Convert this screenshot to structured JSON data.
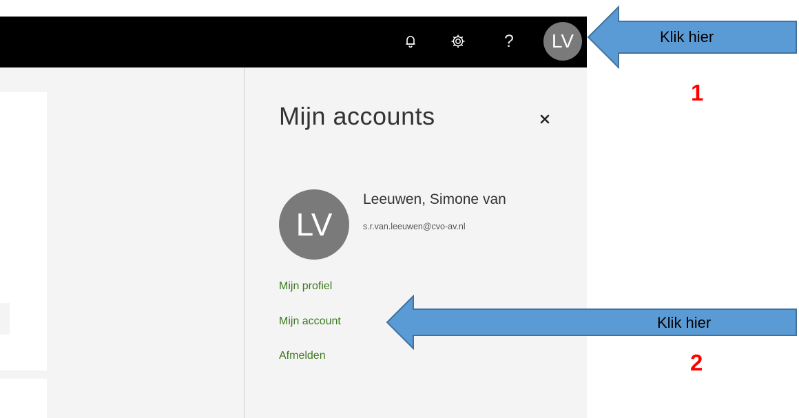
{
  "header": {
    "avatar_initials": "LV",
    "icons": [
      "bell-icon",
      "gear-icon",
      "help-icon"
    ],
    "help_glyph": "?"
  },
  "panel": {
    "title": "Mijn accounts",
    "close_icon": "close-icon",
    "user": {
      "initials": "LV",
      "name": "Leeuwen, Simone van",
      "email": "s.r.van.leeuwen@cvo-av.nl"
    },
    "links": [
      "Mijn profiel",
      "Mijn account",
      "Afmelden"
    ]
  },
  "annotations": [
    {
      "label": "Klik hier",
      "number": "1"
    },
    {
      "label": "Klik hier",
      "number": "2"
    }
  ],
  "colors": {
    "topbar": "#000000",
    "panel_background": "#f4f4f4",
    "avatar": "#7a7a7a",
    "link": "#3b7a1e",
    "annotation_arrow": "#5b9bd5",
    "annotation_arrow_border": "#41719c",
    "annotation_number": "#ff0000"
  }
}
